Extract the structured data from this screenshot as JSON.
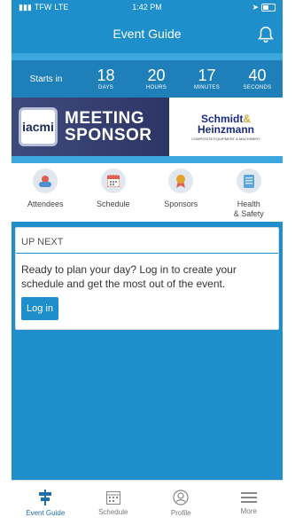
{
  "status_bar": {
    "carrier": "TFW",
    "network": "LTE",
    "time": "1:42 PM"
  },
  "header": {
    "title": "Event Guide"
  },
  "countdown": {
    "label": "Starts in",
    "units": [
      {
        "value": "18",
        "caption": "DAYS"
      },
      {
        "value": "20",
        "caption": "HOURS"
      },
      {
        "value": "17",
        "caption": "MINUTES"
      },
      {
        "value": "40",
        "caption": "SECONDS"
      }
    ]
  },
  "banner": {
    "logo_text": "iacmi",
    "headline_line1": "MEETING",
    "headline_line2": "SPONSOR",
    "sponsor_line1": "Schmidt",
    "sponsor_amp": "&",
    "sponsor_line2": "Heinzmann",
    "sponsor_tagline": "COMPOSITE EQUIPMENT & MACHINERY"
  },
  "quick_links": [
    {
      "label": "Attendees",
      "icon": "people-icon",
      "color": "#e0604f"
    },
    {
      "label": "Schedule",
      "icon": "calendar-icon",
      "color": "#e0604f"
    },
    {
      "label": "Sponsors",
      "icon": "ribbon-icon",
      "color": "#e3a22b"
    },
    {
      "label": "Health\n& Safety",
      "icon": "document-icon",
      "color": "#5aa6dd"
    }
  ],
  "up_next": {
    "title": "UP NEXT",
    "message": "Ready to plan your day? Log in to create your schedule and get the most out of the event.",
    "button": "Log in"
  },
  "tab_bar": {
    "items": [
      {
        "label": "Event Guide",
        "icon": "signpost-icon",
        "active": true
      },
      {
        "label": "Schedule",
        "icon": "calendar-icon",
        "active": false
      },
      {
        "label": "Profile",
        "icon": "profile-icon",
        "active": false
      },
      {
        "label": "More",
        "icon": "menu-icon",
        "active": false
      }
    ]
  },
  "colors": {
    "primary": "#1f8fcb",
    "accent_light": "#3aa7de",
    "banner_navy": "#2d3566"
  }
}
